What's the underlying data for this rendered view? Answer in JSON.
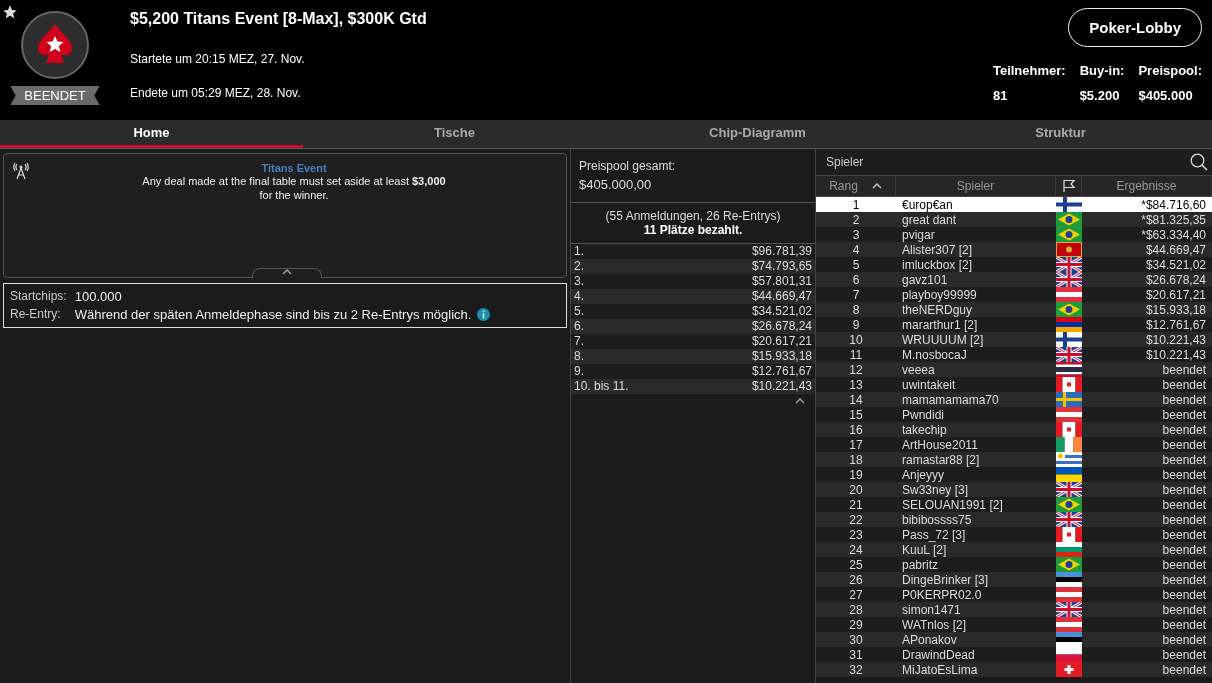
{
  "header": {
    "title": "$5,200 Titans Event [8-Max], $300K Gtd",
    "started": "Startete um 20:15 MEZ, 27. Nov.",
    "ended": "Endete um 05:29 MEZ, 28. Nov.",
    "status": "BEENDET",
    "lobby_button": "Poker-Lobby",
    "stats": [
      {
        "label": "Teilnehmer:",
        "value": "81"
      },
      {
        "label": "Buy-in:",
        "value": "$5.200"
      },
      {
        "label": "Preispool:",
        "value": "$405.000"
      }
    ]
  },
  "tabs": [
    {
      "label": "Home",
      "selected": true
    },
    {
      "label": "Tische",
      "selected": false
    },
    {
      "label": "Chip-Diagramm",
      "selected": false
    },
    {
      "label": "Struktur",
      "selected": false
    }
  ],
  "announcement": {
    "title": "Titans Event",
    "text": "Any deal made at the final table must set aside at least **$3,000** for the winner."
  },
  "details": [
    {
      "label": "Startchips:",
      "value": "100.000",
      "info": false
    },
    {
      "label": "Re-Entry:",
      "value": "Während der späten Anmeldephase sind bis zu 2 Re-Entrys möglich.",
      "info": true
    }
  ],
  "prizepool": {
    "label": "Preispool gesamt:",
    "value": "$405.000,00",
    "entries": "(55 Anmeldungen, 26 Re-Entrys)",
    "paid": "11 Plätze bezahlt.",
    "payouts": [
      {
        "place": "1.",
        "amount": "$96.781,39"
      },
      {
        "place": "2.",
        "amount": "$74.793,65"
      },
      {
        "place": "3.",
        "amount": "$57.801,31"
      },
      {
        "place": "4.",
        "amount": "$44.669,47"
      },
      {
        "place": "5.",
        "amount": "$34.521,02"
      },
      {
        "place": "6.",
        "amount": "$26.678,24"
      },
      {
        "place": "7.",
        "amount": "$20.617,21"
      },
      {
        "place": "8.",
        "amount": "$15.933,18"
      },
      {
        "place": "9.",
        "amount": "$12.761,67"
      },
      {
        "place": "10. bis 11.",
        "amount": "$10.221,43"
      }
    ]
  },
  "players": {
    "search_placeholder": "Spieler",
    "columns": [
      "Rang",
      "Spieler",
      "Ergebnisse"
    ],
    "rows": [
      {
        "rank": "1",
        "name": "€urop€an",
        "kind": "fi",
        "result": "*$84.716,60",
        "selected": true
      },
      {
        "rank": "2",
        "name": "great dant",
        "kind": "br",
        "result": "*$81.325,35",
        "selected": false
      },
      {
        "rank": "3",
        "name": "pvigar",
        "kind": "br",
        "result": "*$63.334,40",
        "selected": false
      },
      {
        "rank": "4",
        "name": "Alister307 [2]",
        "kind": "me",
        "result": "$44.669,47",
        "selected": false
      },
      {
        "rank": "5",
        "name": "imluckbox [2]",
        "kind": "gb",
        "result": "$34.521,02",
        "selected": false
      },
      {
        "rank": "6",
        "name": "gavz101",
        "kind": "gb",
        "result": "$26.678,24",
        "selected": false
      },
      {
        "rank": "7",
        "name": "playboy99999",
        "kind": "at",
        "result": "$20.617,21",
        "selected": false
      },
      {
        "rank": "8",
        "name": "theNERDguy",
        "kind": "br",
        "result": "$15.933,18",
        "selected": false
      },
      {
        "rank": "9",
        "name": "mararthur1 [2]",
        "kind": "am",
        "result": "$12.761,67",
        "selected": false
      },
      {
        "rank": "10",
        "name": "WRUUUUM [2]",
        "kind": "fi",
        "result": "$10.221,43",
        "selected": false
      },
      {
        "rank": "11",
        "name": "M.nosbocaJ",
        "kind": "gb",
        "result": "$10.221,43",
        "selected": false
      },
      {
        "rank": "12",
        "name": "veeea",
        "kind": "th",
        "result": "beendet",
        "selected": false
      },
      {
        "rank": "13",
        "name": "uwintakeit",
        "kind": "ca",
        "result": "beendet",
        "selected": false
      },
      {
        "rank": "14",
        "name": "mamamamama70",
        "kind": "se",
        "result": "beendet",
        "selected": false
      },
      {
        "rank": "15",
        "name": "Pwndidi",
        "kind": "at",
        "result": "beendet",
        "selected": false
      },
      {
        "rank": "16",
        "name": "takechip",
        "kind": "ca",
        "result": "beendet",
        "selected": false
      },
      {
        "rank": "17",
        "name": "ArtHouse2011",
        "kind": "ie",
        "result": "beendet",
        "selected": false
      },
      {
        "rank": "18",
        "name": "ramastar88 [2]",
        "kind": "uy",
        "result": "beendet",
        "selected": false
      },
      {
        "rank": "19",
        "name": "Anjeyyy",
        "kind": "ua",
        "result": "beendet",
        "selected": false
      },
      {
        "rank": "20",
        "name": "Sw33ney [3]",
        "kind": "gb",
        "result": "beendet",
        "selected": false
      },
      {
        "rank": "21",
        "name": "SELOUAN1991 [2]",
        "kind": "br",
        "result": "beendet",
        "selected": false
      },
      {
        "rank": "22",
        "name": "bibibossss75",
        "kind": "gb",
        "result": "beendet",
        "selected": false
      },
      {
        "rank": "23",
        "name": "Pass_72 [3]",
        "kind": "ca",
        "result": "beendet",
        "selected": false
      },
      {
        "rank": "24",
        "name": "KuuL [2]",
        "kind": "bg",
        "result": "beendet",
        "selected": false
      },
      {
        "rank": "25",
        "name": "pabritz",
        "kind": "br",
        "result": "beendet",
        "selected": false
      },
      {
        "rank": "26",
        "name": "DingeBrinker [3]",
        "kind": "ee",
        "result": "beendet",
        "selected": false
      },
      {
        "rank": "27",
        "name": "P0KERPR02.0",
        "kind": "at",
        "result": "beendet",
        "selected": false
      },
      {
        "rank": "28",
        "name": "simon1471",
        "kind": "gb",
        "result": "beendet",
        "selected": false
      },
      {
        "rank": "29",
        "name": "WATnlos [2]",
        "kind": "at",
        "result": "beendet",
        "selected": false
      },
      {
        "rank": "30",
        "name": "APonakov",
        "kind": "ee",
        "result": "beendet",
        "selected": false
      },
      {
        "rank": "31",
        "name": "DrawindDead",
        "kind": "pl",
        "result": "beendet",
        "selected": false
      },
      {
        "rank": "32",
        "name": "MiJatoEsLima",
        "kind": "ch",
        "result": "beendet",
        "selected": false
      }
    ]
  }
}
